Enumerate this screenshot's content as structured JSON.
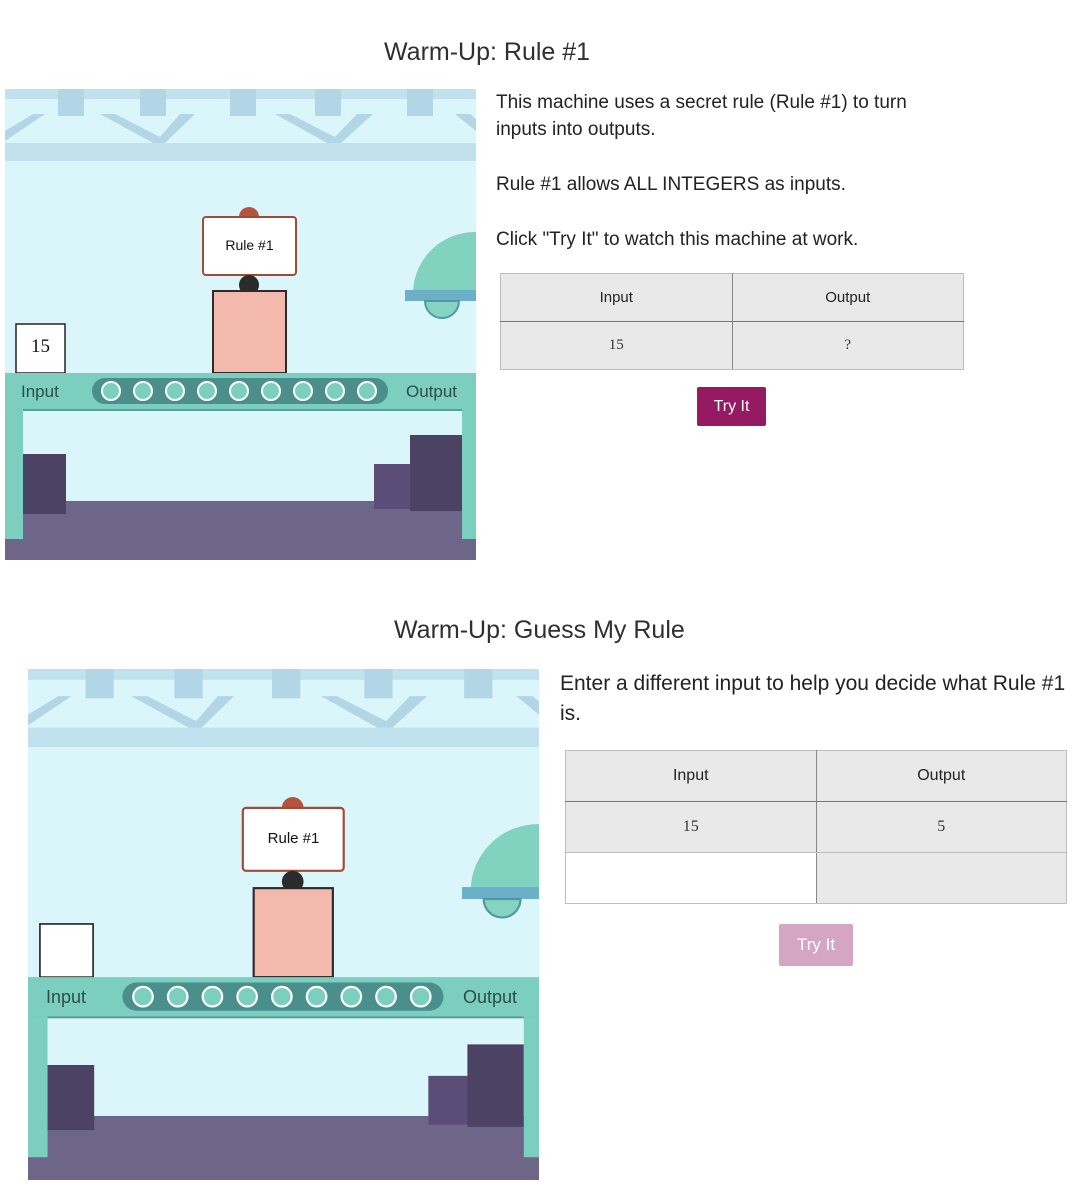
{
  "section1": {
    "title": "Warm-Up: Rule #1",
    "machine": {
      "sign": "Rule #1",
      "input_label": "Input",
      "output_label": "Output",
      "box_value": "15"
    },
    "paragraphs": [
      "This machine uses a secret rule (Rule #1) to turn inputs into outputs.",
      "Rule #1 allows ALL INTEGERS as inputs.",
      "Click \"Try It\" to watch this machine at work."
    ],
    "table": {
      "headers": [
        "Input",
        "Output"
      ],
      "rows": [
        [
          "15",
          "?"
        ]
      ]
    },
    "button": "Try It"
  },
  "section2": {
    "title": "Warm-Up: Guess My Rule",
    "machine": {
      "sign": "Rule #1",
      "input_label": "Input",
      "output_label": "Output",
      "box_value": ""
    },
    "paragraph": "Enter a different input to help you decide what Rule #1 is.",
    "table": {
      "headers": [
        "Input",
        "Output"
      ],
      "rows": [
        [
          "15",
          "5"
        ]
      ],
      "input_value": "",
      "output_value": ""
    },
    "button": "Try It"
  },
  "colors": {
    "button_active": "#961a62",
    "button_disabled": "#d4a6c4",
    "machine_sky": "#daf6fb",
    "floor": "#6e6689",
    "conveyor": "#4a8f8c",
    "press_body": "#f4b9ad"
  }
}
